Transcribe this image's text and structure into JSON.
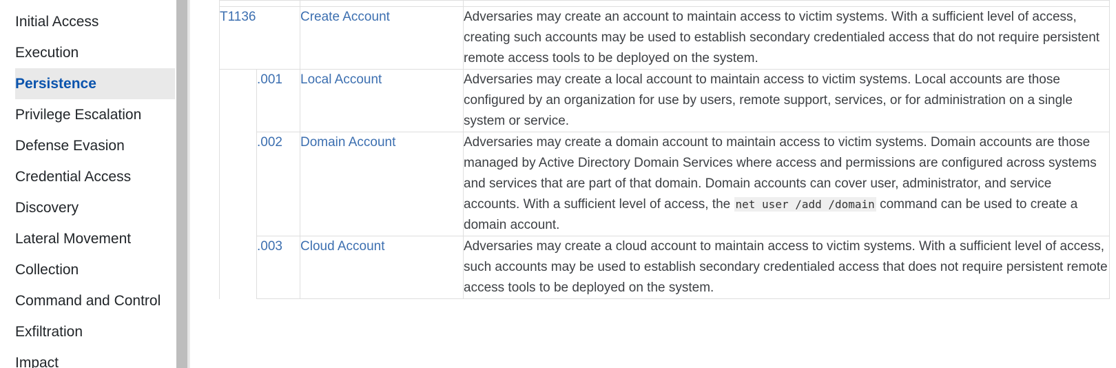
{
  "sidebar": {
    "tactics": [
      {
        "label": "Initial Access"
      },
      {
        "label": "Execution"
      },
      {
        "label": "Persistence",
        "active": true
      },
      {
        "label": "Privilege Escalation"
      },
      {
        "label": "Defense Evasion"
      },
      {
        "label": "Credential Access"
      },
      {
        "label": "Discovery"
      },
      {
        "label": "Lateral Movement"
      },
      {
        "label": "Collection"
      },
      {
        "label": "Command and Control"
      },
      {
        "label": "Exfiltration"
      },
      {
        "label": "Impact"
      }
    ]
  },
  "colors": {
    "active_tactic": "#0b54ad",
    "active_bg": "#e9e9e9",
    "link": "#3c6fb0",
    "scrollbar": "#bdbdbd"
  },
  "technique": {
    "id": "T1136",
    "name": "Create Account",
    "description": "Adversaries may create an account to maintain access to victim systems. With a sufficient level of access, creating such accounts may be used to establish secondary credentialed access that do not require persistent remote access tools to be deployed on the system.",
    "subtechniques": [
      {
        "id": ".001",
        "name": "Local Account",
        "description": "Adversaries may create a local account to maintain access to victim systems. Local accounts are those configured by an organization for use by users, remote support, services, or for administration on a single system or service."
      },
      {
        "id": ".002",
        "name": "Domain Account",
        "description_before": "Adversaries may create a domain account to maintain access to victim systems. Domain accounts are those managed by Active Directory Domain Services where access and permissions are configured across systems and services that are part of that domain. Domain accounts can cover user, administrator, and service accounts. With a sufficient level of access, the ",
        "code": "net user /add /domain",
        "description_after": " command can be used to create a domain account."
      },
      {
        "id": ".003",
        "name": "Cloud Account",
        "description": "Adversaries may create a cloud account to maintain access to victim systems. With a sufficient level of access, such accounts may be used to establish secondary credentialed access that does not require persistent remote access tools to be deployed on the system."
      }
    ]
  }
}
